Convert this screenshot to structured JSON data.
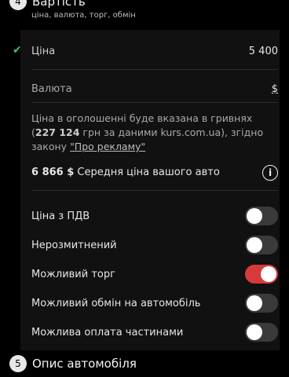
{
  "section4": {
    "number": "4",
    "title": "Вартість",
    "subtitle": "ціна, валюта, торг, обмін"
  },
  "price": {
    "label": "Ціна",
    "value": "5 400",
    "check_icon": "check-icon",
    "check_color": "#3fbf6a"
  },
  "currency": {
    "label": "Валюта",
    "value": "$"
  },
  "info": {
    "text_part1": "Ціна в оголошенні буде вказана в гривнях (",
    "uah_amount": "227 124",
    "text_part2": " грн за даними kurs.com.ua), згідно закону ",
    "link_text": "\"Про рекламу\""
  },
  "average": {
    "amount": "6 866 $",
    "label": " Середня ціна вашого авто",
    "icon": "info-icon"
  },
  "toggles": [
    {
      "label": "Ціна з ПДВ",
      "on": false
    },
    {
      "label": "Нерозмитнений",
      "on": false
    },
    {
      "label": "Можливий торг",
      "on": true
    },
    {
      "label": "Можливий обмін на автомобіль",
      "on": false
    },
    {
      "label": "Можлива оплата частинами",
      "on": false
    }
  ],
  "colors": {
    "toggle_on": "#d63a3a",
    "toggle_off": "#3a3a3a",
    "accent_green": "#3fbf6a"
  },
  "section5": {
    "number": "5",
    "title": "Опис автомобіля"
  }
}
